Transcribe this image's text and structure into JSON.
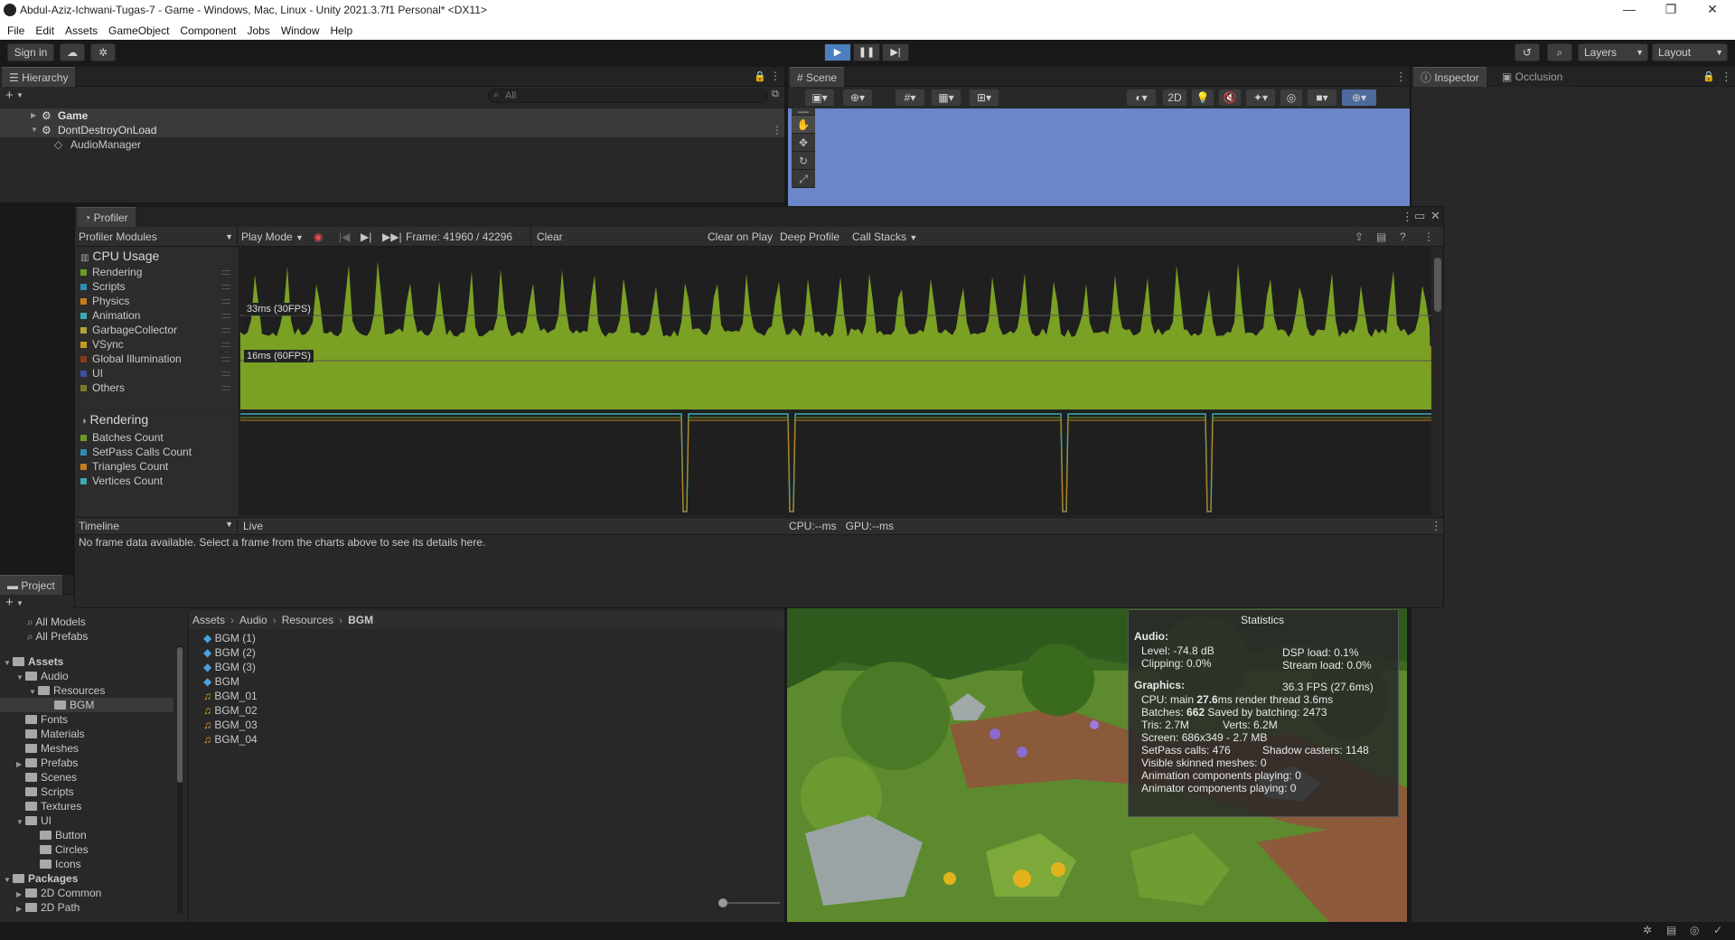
{
  "window": {
    "title": "Abdul-Aziz-Ichwani-Tugas-7 - Game - Windows, Mac, Linux - Unity 2021.3.7f1 Personal* <DX11>",
    "minimize": "—",
    "maximize": "❐",
    "close": "✕"
  },
  "menu": [
    "File",
    "Edit",
    "Assets",
    "GameObject",
    "Component",
    "Jobs",
    "Window",
    "Help"
  ],
  "toolbar": {
    "sign_in": "Sign in",
    "layers": "Layers",
    "layout": "Layout"
  },
  "hierarchy": {
    "tab": "Hierarchy",
    "search_placeholder": "All",
    "rows": [
      {
        "label": "Game"
      },
      {
        "label": "DontDestroyOnLoad"
      },
      {
        "label": "AudioManager"
      }
    ]
  },
  "scene": {
    "tab": "Scene",
    "mode_2d": "2D"
  },
  "inspector": {
    "tab_inspector": "Inspector",
    "tab_occlusion": "Occlusion"
  },
  "profiler": {
    "tab": "Profiler",
    "modules_label": "Profiler Modules",
    "play_mode": "Play Mode",
    "frame": "Frame: 41960 / 42296",
    "clear": "Clear",
    "clear_on_play": "Clear on Play",
    "deep_profile": "Deep Profile",
    "call_stacks": "Call Stacks",
    "cpu_module": {
      "title": "CPU Usage",
      "items": [
        {
          "label": "Rendering",
          "color": "#6a9c24"
        },
        {
          "label": "Scripts",
          "color": "#2c8fb0"
        },
        {
          "label": "Physics",
          "color": "#c47f19"
        },
        {
          "label": "Animation",
          "color": "#3daab0"
        },
        {
          "label": "GarbageCollector",
          "color": "#b8a23a"
        },
        {
          "label": "VSync",
          "color": "#c29b18"
        },
        {
          "label": "Global Illumination",
          "color": "#8a3a18"
        },
        {
          "label": "UI",
          "color": "#3a4ea0"
        },
        {
          "label": "Others",
          "color": "#7a7a2a"
        }
      ],
      "marker_33": "33ms (30FPS)",
      "marker_16": "16ms (60FPS)"
    },
    "rendering_module": {
      "title": "Rendering",
      "items": [
        {
          "label": "Batches Count",
          "color": "#6a9c24"
        },
        {
          "label": "SetPass Calls Count",
          "color": "#2c8fb0"
        },
        {
          "label": "Triangles Count",
          "color": "#c47f19"
        },
        {
          "label": "Vertices Count",
          "color": "#3daab0"
        }
      ]
    },
    "timeline": "Timeline",
    "live": "Live",
    "cpu_gpu": "CPU:--ms   GPU:--ms",
    "no_data": "No frame data available. Select a frame from the charts above to see its details here."
  },
  "project": {
    "tab": "Project",
    "favorites": [
      "All Models",
      "All Prefabs"
    ],
    "tree": [
      {
        "label": "Assets",
        "bold": true
      },
      {
        "label": "Audio"
      },
      {
        "label": "Resources"
      },
      {
        "label": "BGM"
      },
      {
        "label": "Fonts"
      },
      {
        "label": "Materials"
      },
      {
        "label": "Meshes"
      },
      {
        "label": "Prefabs"
      },
      {
        "label": "Scenes"
      },
      {
        "label": "Scripts"
      },
      {
        "label": "Textures"
      },
      {
        "label": "UI"
      },
      {
        "label": "Button"
      },
      {
        "label": "Circles"
      },
      {
        "label": "Icons"
      },
      {
        "label": "Packages",
        "bold": true
      },
      {
        "label": "2D Common"
      },
      {
        "label": "2D Path"
      }
    ],
    "breadcrumb": [
      "Assets",
      "Audio",
      "Resources",
      "BGM"
    ],
    "files": [
      {
        "label": "BGM (1)",
        "type": "prefab"
      },
      {
        "label": "BGM (2)",
        "type": "prefab"
      },
      {
        "label": "BGM (3)",
        "type": "prefab"
      },
      {
        "label": "BGM",
        "type": "prefab"
      },
      {
        "label": "BGM_01",
        "type": "audio"
      },
      {
        "label": "BGM_02",
        "type": "audio"
      },
      {
        "label": "BGM_03",
        "type": "audio"
      },
      {
        "label": "BGM_04",
        "type": "audio"
      }
    ]
  },
  "statistics": {
    "title": "Statistics",
    "audio_label": "Audio:",
    "level": "Level: -74.8 dB",
    "clipping": "Clipping: 0.0%",
    "dsp": "DSP load: 0.1%",
    "stream": "Stream load: 0.0%",
    "graphics_label": "Graphics:",
    "fps": "36.3 FPS (27.6ms)",
    "cpu_main_prefix": "CPU: main ",
    "cpu_main_value": "27.6",
    "cpu_main_suffix": "ms  render thread 3.6ms",
    "batches_prefix": "Batches: ",
    "batches_value": "662",
    "batches_suffix": "   Saved by batching: 2473",
    "tris": "Tris: 2.7M",
    "verts": "Verts: 6.2M",
    "screen": "Screen: 686x349 - 2.7 MB",
    "setpass": "SetPass calls: 476",
    "shadow": "Shadow casters: 1148",
    "skinned": "Visible skinned meshes: 0",
    "anim": "Animation components playing: 0",
    "animator": "Animator components playing: 0"
  }
}
